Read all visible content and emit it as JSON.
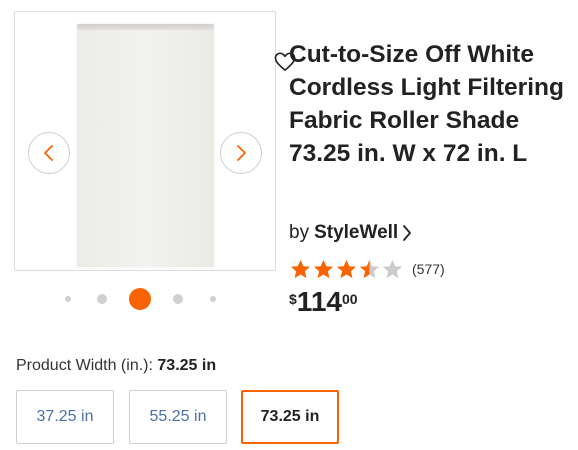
{
  "product": {
    "title": "Cut-to-Size Off White Cordless Light Filtering Fabric Roller Shade 73.25 in. W x 72 in. L",
    "brand_prefix": "by",
    "brand": "StyleWell",
    "rating": 3.5,
    "rating_max": 5,
    "review_count": "(577)",
    "price": {
      "currency": "$",
      "dollars": "114",
      "cents": "00"
    }
  },
  "gallery": {
    "current_index": 2,
    "total": 5,
    "icons": {
      "prev": "chevron-left-icon",
      "next": "chevron-right-icon",
      "favorite": "heart-icon"
    }
  },
  "width_selector": {
    "label": "Product Width (in.):",
    "selected_value": "73.25 in",
    "options": [
      "37.25 in",
      "55.25 in",
      "73.25 in"
    ]
  },
  "colors": {
    "accent": "#f96302",
    "option_text": "#4a6fa5"
  }
}
